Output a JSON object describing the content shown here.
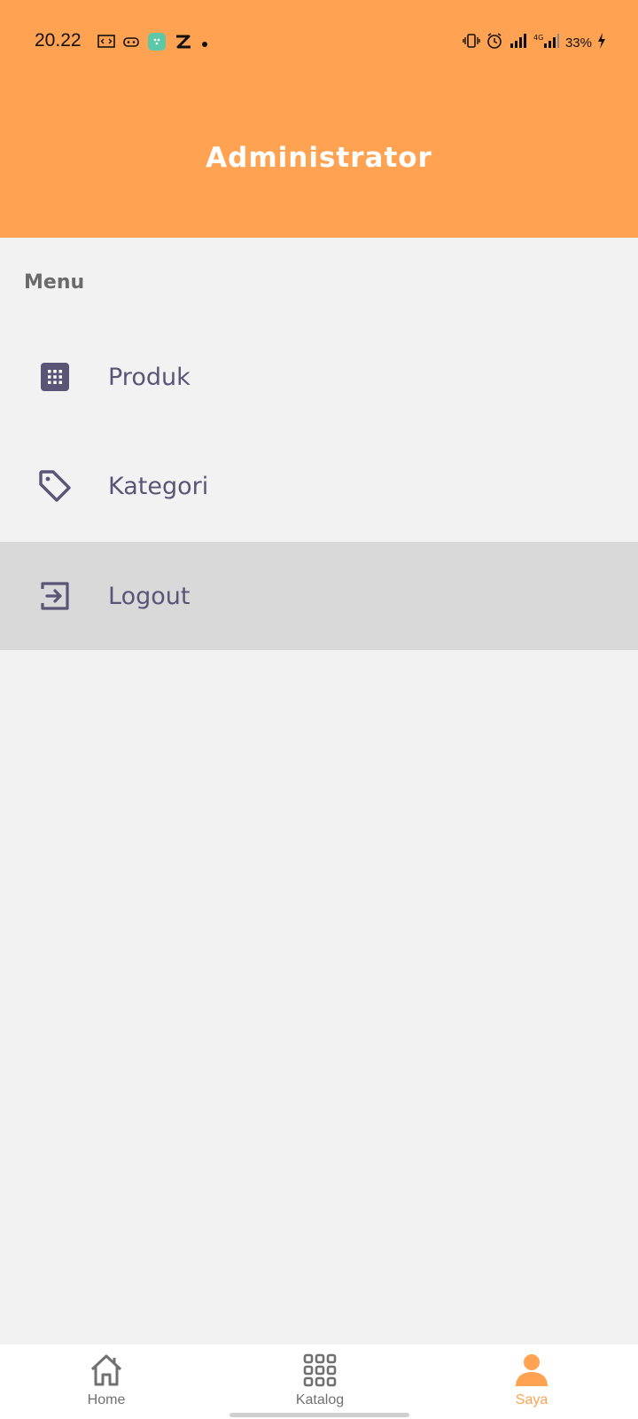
{
  "status_bar": {
    "time": "20.22",
    "battery": "33%"
  },
  "header": {
    "title": "Administrator",
    "background": "#FFA352"
  },
  "menu": {
    "section_label": "Menu",
    "items": [
      {
        "label": "Produk",
        "icon": "grid-icon"
      },
      {
        "label": "Kategori",
        "icon": "tag-icon"
      },
      {
        "label": "Logout",
        "icon": "logout-icon",
        "active": true
      }
    ]
  },
  "bottom_nav": {
    "items": [
      {
        "label": "Home",
        "icon": "home-icon"
      },
      {
        "label": "Katalog",
        "icon": "catalog-grid-icon"
      },
      {
        "label": "Saya",
        "icon": "user-icon",
        "active": true
      }
    ],
    "active_color": "#FFA352",
    "inactive_color": "#707070"
  },
  "colors": {
    "accent": "#FFA352",
    "menu_text": "#5a5577",
    "background": "#f2f2f2",
    "active_row": "#d9d9d9"
  }
}
